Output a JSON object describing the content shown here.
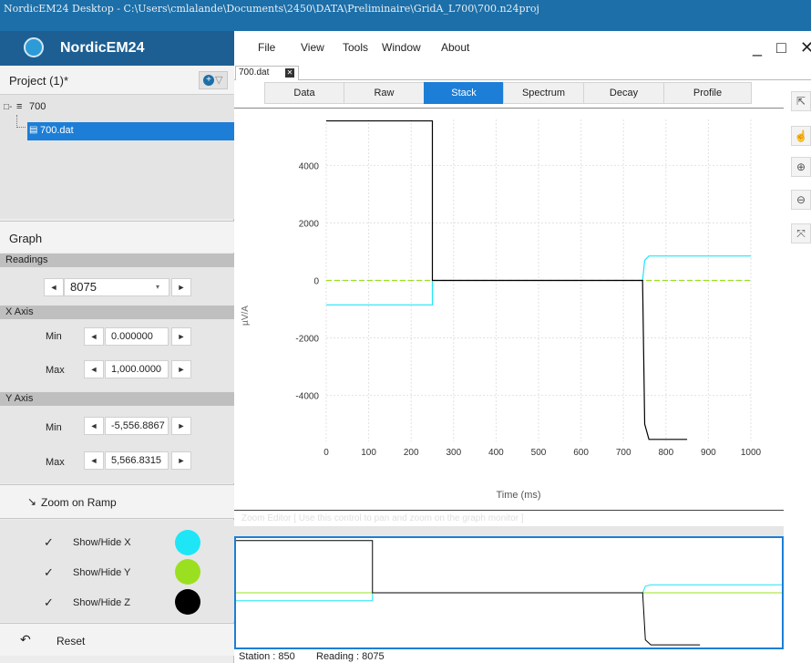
{
  "window": {
    "title": "NordicEM24 Desktop - C:\\Users\\cmlalande\\Documents\\2450\\DATA\\Preliminaire\\GridA_L700\\700.n24proj"
  },
  "brand": {
    "name": "NordicEM24"
  },
  "menu": {
    "items": [
      "File",
      "View",
      "Tools",
      "Window",
      "About"
    ],
    "minimize": "_",
    "maximize": "□",
    "close": "✕"
  },
  "project": {
    "title": "Project (1)*",
    "tree_root": "700",
    "tree_file": "700.dat"
  },
  "graph": {
    "title": "Graph",
    "readings": {
      "label": "Readings",
      "value": "8075"
    },
    "x_axis": {
      "label": "X Axis",
      "min_label": "Min",
      "min": "0.000000",
      "max_label": "Max",
      "max": "1,000.0000"
    },
    "y_axis": {
      "label": "Y Axis",
      "min_label": "Min",
      "min": "-5,556.8867",
      "max_label": "Max",
      "max": "5,566.8315"
    },
    "zoom_on_ramp": "Zoom on Ramp",
    "show_x": "Show/Hide X",
    "show_y": "Show/Hide Y",
    "show_z": "Show/Hide Z",
    "reset": "Reset"
  },
  "colors": {
    "x": "#1ee6f7",
    "y": "#9be020",
    "z": "#000000",
    "accent": "#1c7ed6"
  },
  "doc_tab": "700.dat",
  "view_tabs": [
    "Data",
    "Raw",
    "Stack",
    "Spectrum",
    "Decay",
    "Profile"
  ],
  "active_tab": "Stack",
  "zoom_editor": "Zoom Editor [ Use this control to pan and zoom on the graph monitor ]",
  "status": {
    "station": "Station : 850",
    "reading": "Reading : 8075"
  },
  "chart_data": {
    "type": "line",
    "xlabel": "Time (ms)",
    "ylabel": "µV/A",
    "xlim": [
      0,
      1000
    ],
    "ylim": [
      -5600,
      5600
    ],
    "x_ticks": [
      0,
      100,
      200,
      300,
      400,
      500,
      600,
      700,
      800,
      900,
      1000
    ],
    "y_ticks": [
      -4000,
      -2000,
      0,
      2000,
      4000
    ],
    "grid": true,
    "series": [
      {
        "name": "X",
        "color": "#1ee6f7",
        "x": [
          0,
          250,
          250,
          745,
          750,
          760,
          1000
        ],
        "values": [
          -850,
          -850,
          0,
          0,
          700,
          850,
          850
        ]
      },
      {
        "name": "Y",
        "color": "#9be020",
        "x": [
          0,
          1000
        ],
        "values": [
          0,
          0
        ]
      },
      {
        "name": "Z",
        "color": "#000000",
        "x": [
          0,
          250,
          250,
          745,
          750,
          760,
          850
        ],
        "values": [
          5550,
          5550,
          0,
          0,
          -5000,
          -5530,
          -5530
        ]
      }
    ]
  }
}
